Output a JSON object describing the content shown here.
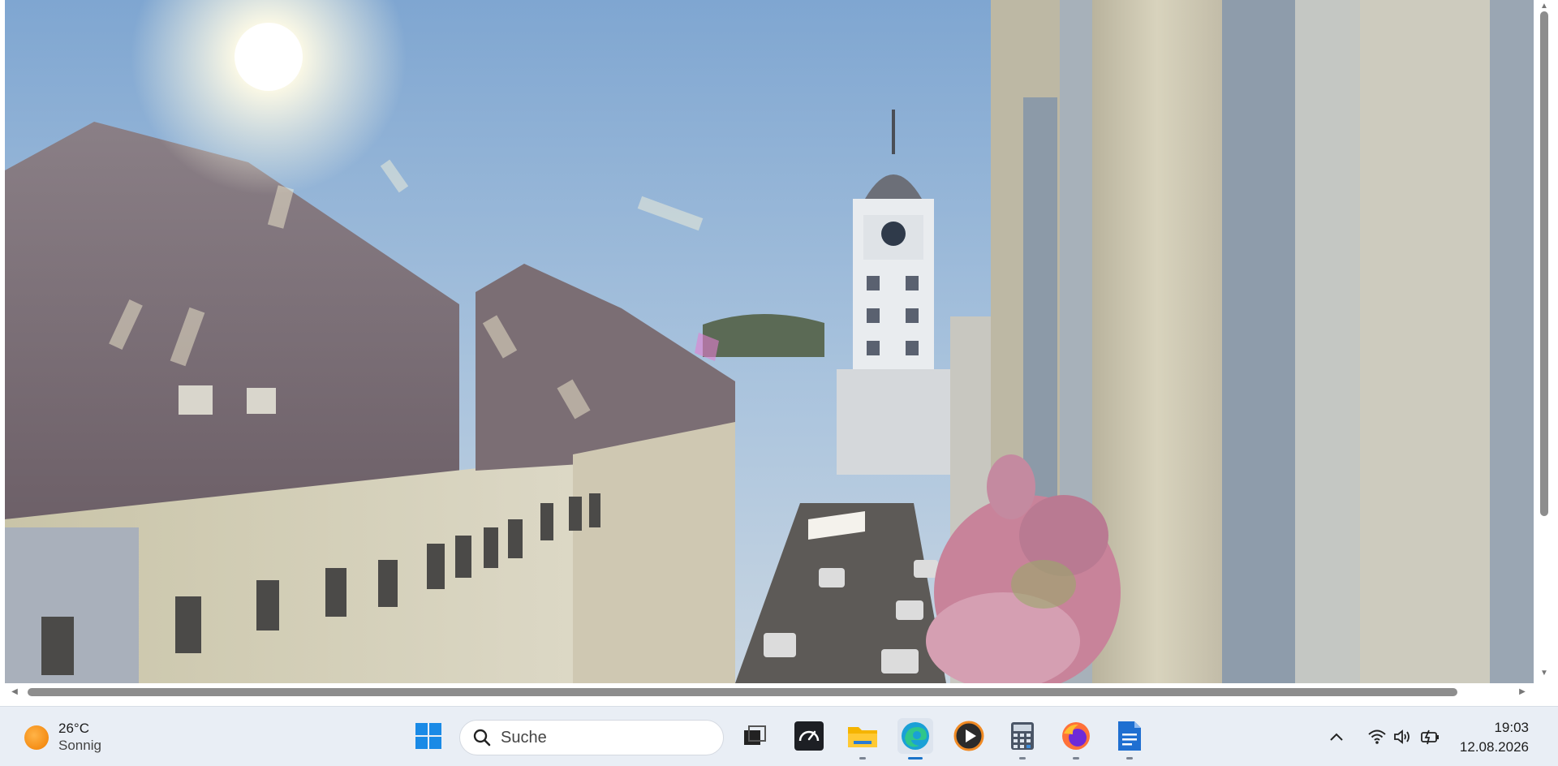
{
  "browser": {
    "content": "webcam-image"
  },
  "taskbar": {
    "weather": {
      "temp": "26°C",
      "condition": "Sonnig"
    },
    "search": {
      "placeholder": "Suche"
    },
    "apps": [
      {
        "name": "start",
        "icon": "windows-icon"
      },
      {
        "name": "task-view",
        "icon": "task-view-icon"
      },
      {
        "name": "speedometer",
        "icon": "speedometer-icon"
      },
      {
        "name": "file-explorer",
        "icon": "folder-icon"
      },
      {
        "name": "edge",
        "icon": "edge-icon",
        "active": true
      },
      {
        "name": "media-player",
        "icon": "play-icon"
      },
      {
        "name": "calculator",
        "icon": "calculator-icon"
      },
      {
        "name": "firefox",
        "icon": "firefox-icon"
      },
      {
        "name": "docs",
        "icon": "document-icon"
      }
    ],
    "tray": [
      "chevron-up-icon",
      "wifi-icon",
      "volume-icon",
      "battery-icon"
    ],
    "clock": {
      "time": "19:03",
      "date": "12.08.2026"
    }
  },
  "colors": {
    "accent": "#1a73c9",
    "taskbar_bg": "#e9eef5"
  }
}
